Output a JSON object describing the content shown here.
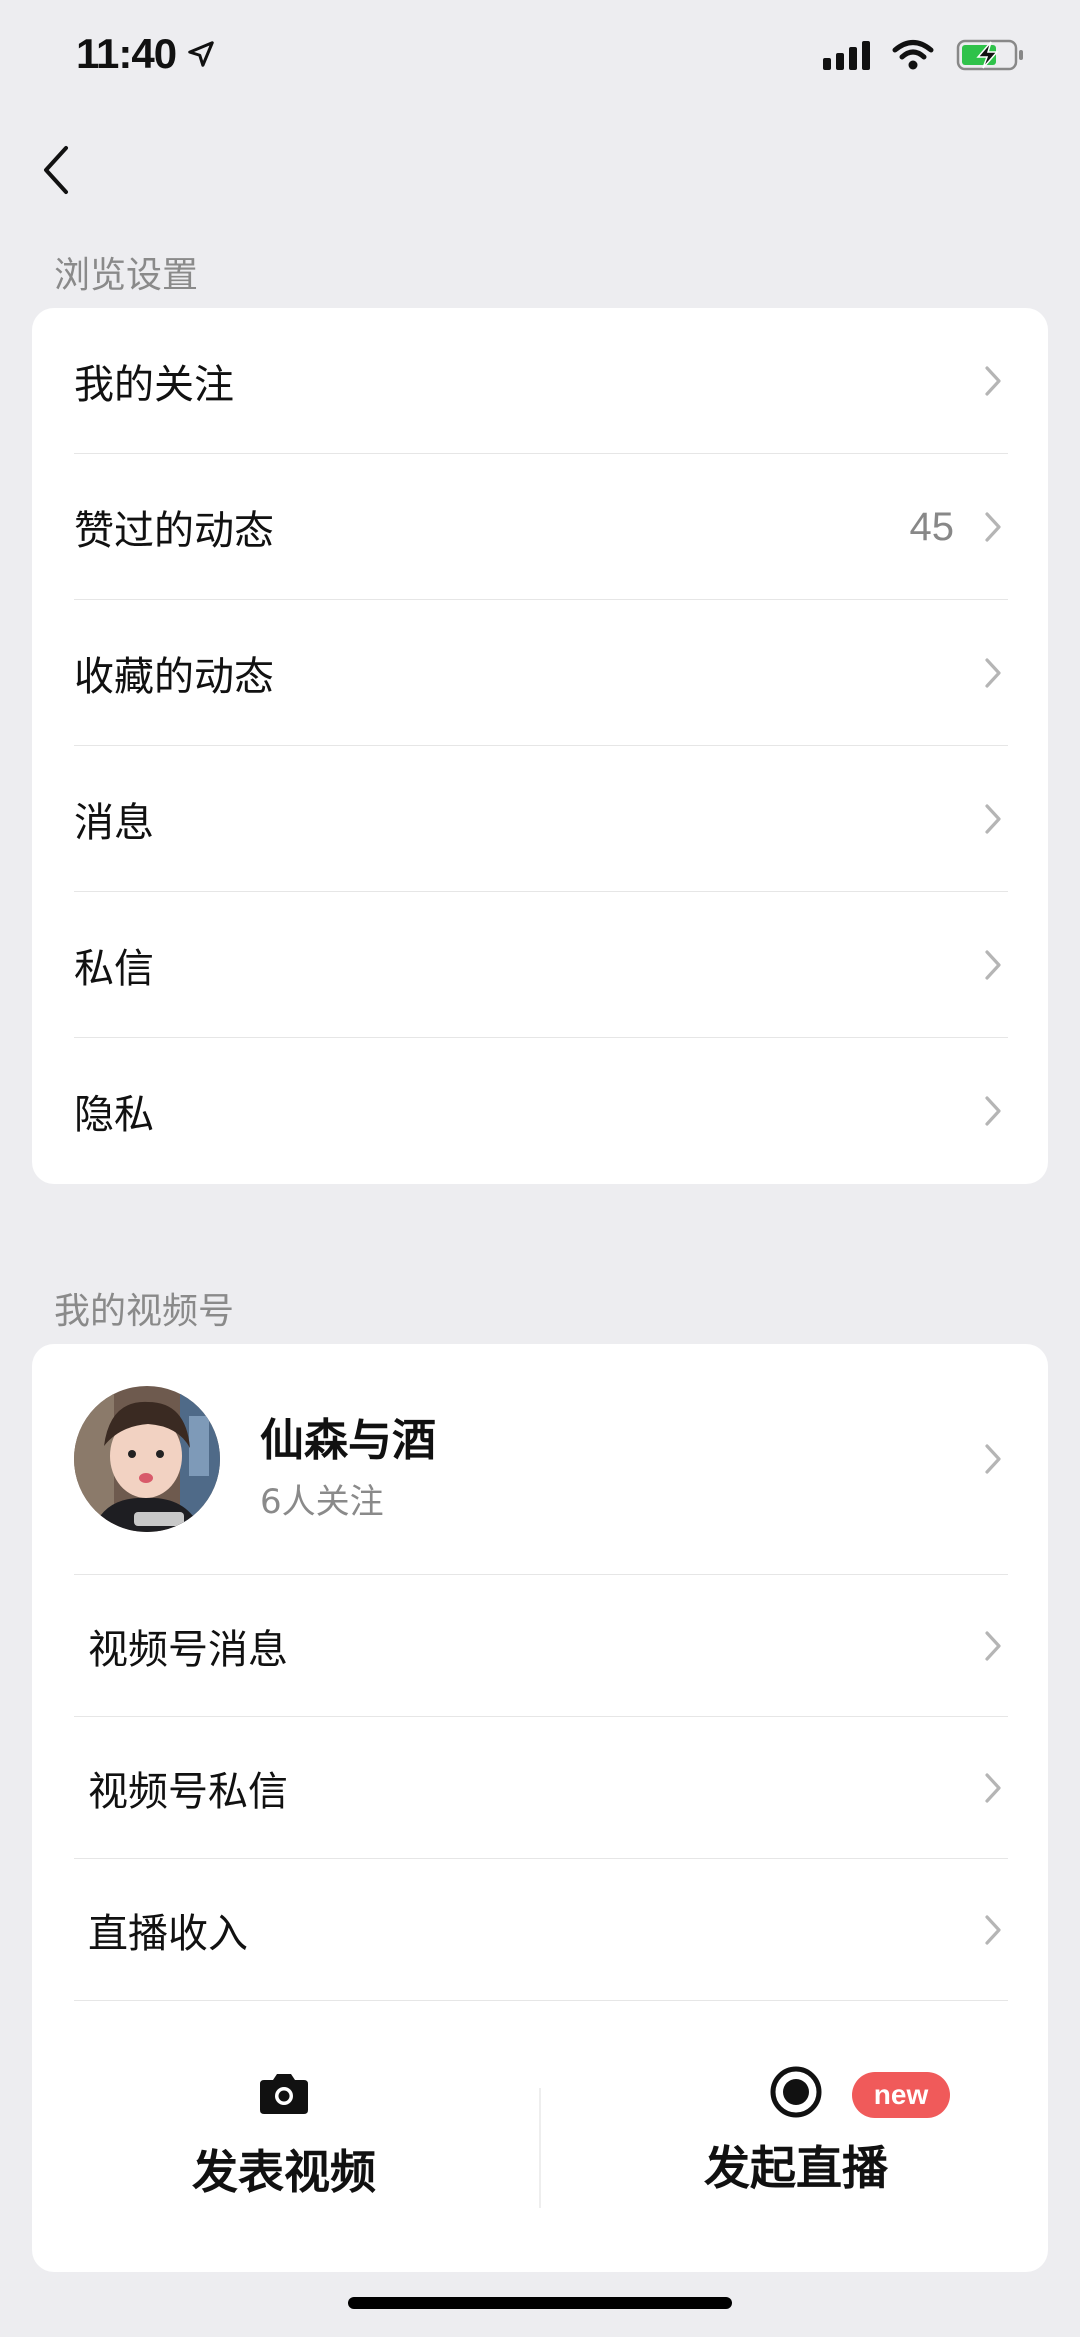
{
  "status_bar": {
    "time": "11:40"
  },
  "browse_settings": {
    "title": "浏览设置",
    "items": [
      {
        "label": "我的关注",
        "count": ""
      },
      {
        "label": "赞过的动态",
        "count": "45"
      },
      {
        "label": "收藏的动态",
        "count": ""
      },
      {
        "label": "消息",
        "count": ""
      },
      {
        "label": "私信",
        "count": ""
      },
      {
        "label": "隐私",
        "count": ""
      }
    ]
  },
  "channels": {
    "title": "我的视频号",
    "profile": {
      "name": "仙森与酒",
      "followers": "6人关注"
    },
    "items": [
      {
        "label": "视频号消息"
      },
      {
        "label": "视频号私信"
      },
      {
        "label": "直播收入"
      }
    ],
    "actions": {
      "post_video": "发表视频",
      "start_live": "发起直播",
      "new_badge": "new"
    }
  },
  "colors": {
    "background": "#ededf0",
    "badge": "#f05a5a"
  },
  "icons": [
    "location-arrow-icon",
    "signal-icon",
    "wifi-icon",
    "battery-charging-icon",
    "back-chevron-icon",
    "chevron-right-icon",
    "camera-icon",
    "live-record-icon"
  ]
}
